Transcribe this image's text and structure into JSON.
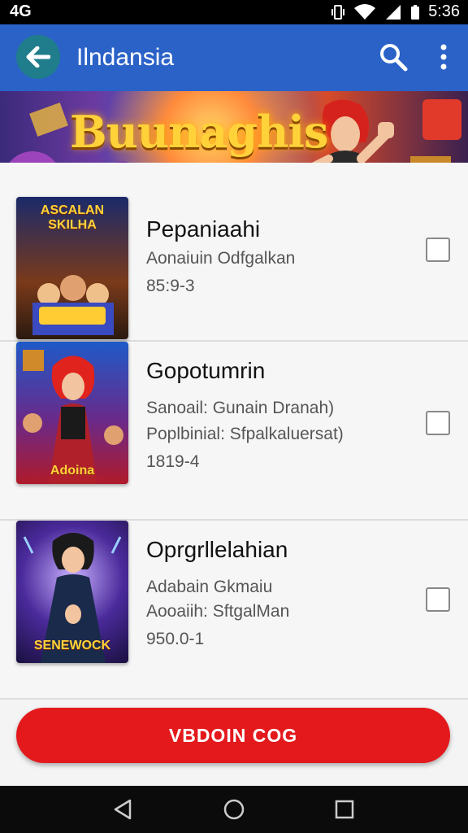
{
  "status_bar": {
    "left_text": "4G",
    "time": "5:36"
  },
  "app_bar": {
    "title": "Ilndansia",
    "back_icon": "arrow-left-icon",
    "search_icon": "search-icon",
    "more_icon": "more-vert-icon"
  },
  "banner": {
    "title": "Buunaghis"
  },
  "items": [
    {
      "title": "Pepaniaahi",
      "lines": [
        "Aonaiuin Odfgalkan"
      ],
      "code": "85:9-3",
      "thumb_caption": "ASCALAN SKILHA",
      "checked": false
    },
    {
      "title": "Gopotumrin",
      "lines": [
        "Sanoail: Gunain Dranah)",
        "Poplbinial: Sfpalkaluersat)"
      ],
      "code": "1819-4",
      "thumb_caption": "Adoina",
      "checked": false
    },
    {
      "title": "Oprgrllelahian",
      "lines": [
        "Adabain Gkmaiu",
        "Aooaiih: SftgalMan"
      ],
      "code": "950.0-1",
      "thumb_caption": "SENEWOCK",
      "checked": false
    }
  ],
  "cta": {
    "label": "VBDOIN COG"
  },
  "nav_bar": {
    "back_icon": "nav-back-icon",
    "home_icon": "nav-home-icon",
    "recents_icon": "nav-recents-icon"
  }
}
